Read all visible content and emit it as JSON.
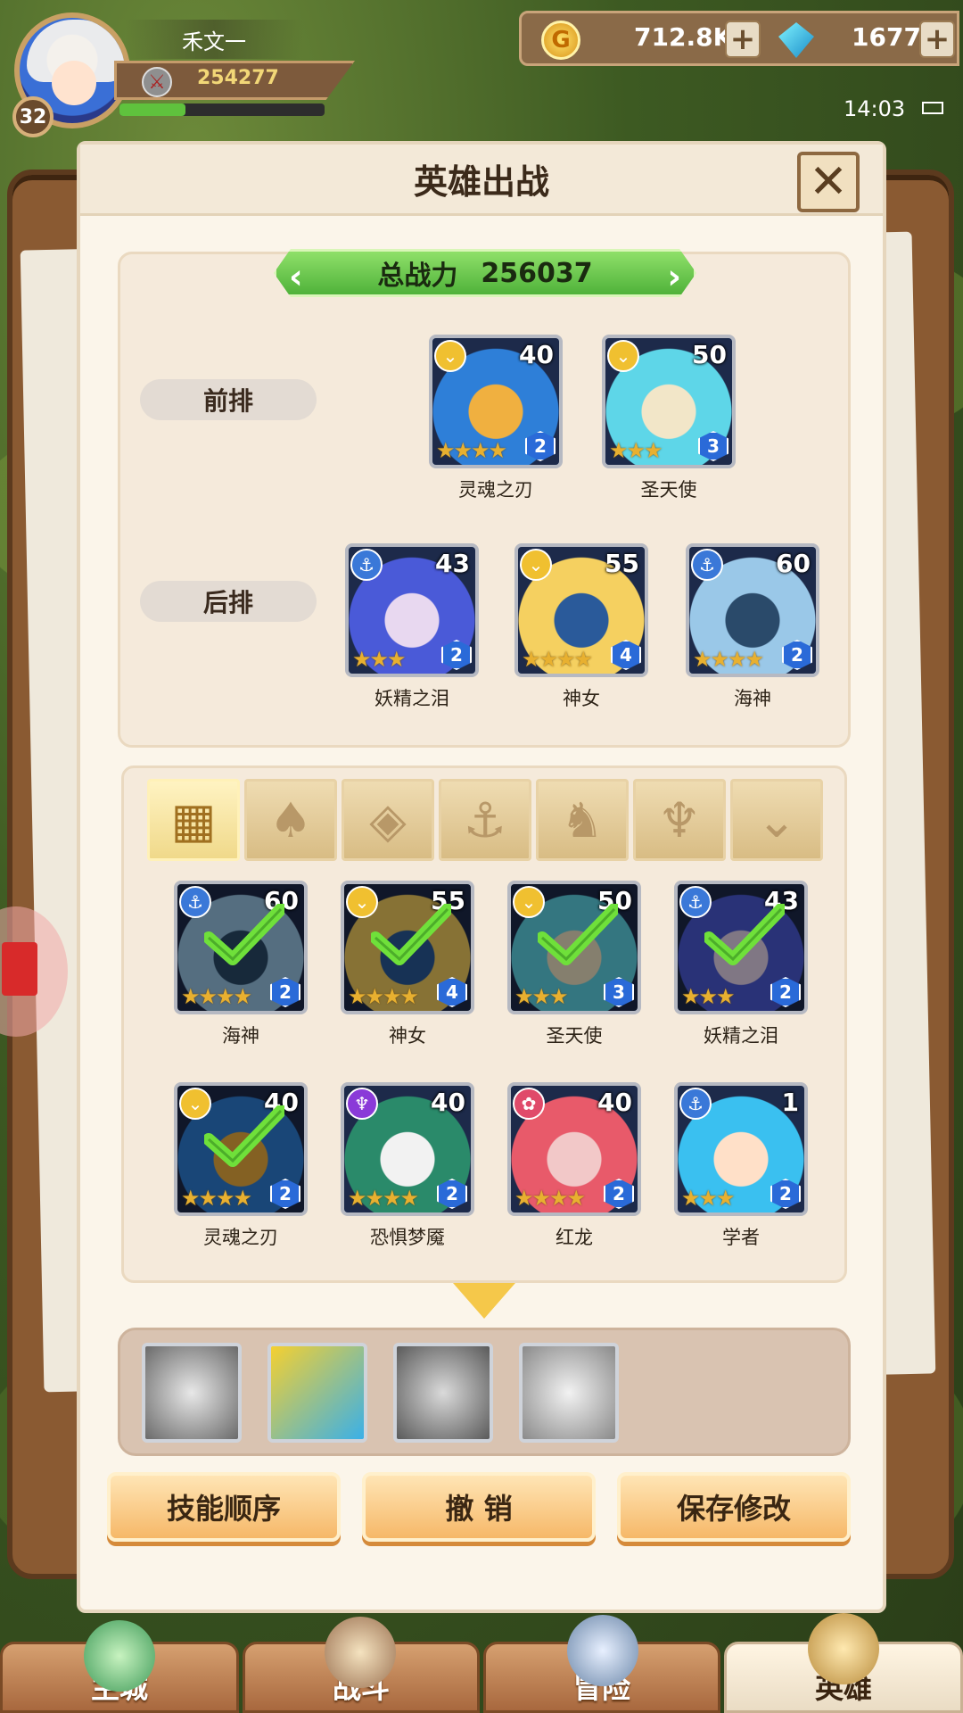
{
  "player": {
    "name": "禾文一",
    "level": "32",
    "power": "254277",
    "exp_fraction": 0.32
  },
  "currency": {
    "gold": "712.8K",
    "gems": "1677",
    "plus": "+"
  },
  "status": {
    "time": "14:03"
  },
  "dialog": {
    "title": "英雄出战",
    "close": "✕",
    "total_power_label": "总战力",
    "total_power_value": "256037",
    "front_row_label": "前排",
    "back_row_label": "后排"
  },
  "front_row": [
    {
      "name": "灵魂之刃",
      "level": "40",
      "stars": "★★★★",
      "tier": "2",
      "class": "shield"
    },
    {
      "name": "圣天使",
      "level": "50",
      "stars": "★★★",
      "tier": "3",
      "class": "shield"
    }
  ],
  "back_row": [
    {
      "name": "妖精之泪",
      "level": "43",
      "stars": "★★★",
      "tier": "2",
      "class": "anchor"
    },
    {
      "name": "神女",
      "level": "55",
      "stars": "★★★★",
      "tier": "4",
      "class": "shield"
    },
    {
      "name": "海神",
      "level": "60",
      "stars": "★★★★",
      "tier": "2",
      "class": "anchor"
    }
  ],
  "filters": [
    "all-icon",
    "nature-icon",
    "diamond-icon",
    "anchor-icon",
    "beast-icon",
    "horn-icon",
    "shield-icon"
  ],
  "roster": [
    {
      "name": "海神",
      "level": "60",
      "stars": "★★★★",
      "tier": "2",
      "class": "anchor",
      "selected": true
    },
    {
      "name": "神女",
      "level": "55",
      "stars": "★★★★",
      "tier": "4",
      "class": "shield",
      "selected": true
    },
    {
      "name": "圣天使",
      "level": "50",
      "stars": "★★★",
      "tier": "3",
      "class": "shield",
      "selected": true
    },
    {
      "name": "妖精之泪",
      "level": "43",
      "stars": "★★★",
      "tier": "2",
      "class": "anchor",
      "selected": true
    },
    {
      "name": "灵魂之刃",
      "level": "40",
      "stars": "★★★★",
      "tier": "2",
      "class": "shield",
      "selected": true
    },
    {
      "name": "恐惧梦魇",
      "level": "40",
      "stars": "★★★★",
      "tier": "2",
      "class": "horn",
      "selected": false
    },
    {
      "name": "红龙",
      "level": "40",
      "stars": "★★★★",
      "tier": "2",
      "class": "flame",
      "selected": false
    },
    {
      "name": "学者",
      "level": "1",
      "stars": "★★★",
      "tier": "2",
      "class": "anchor",
      "selected": false
    }
  ],
  "skills": [
    "skill-1-icon",
    "skill-2-icon",
    "skill-3-icon",
    "skill-4-icon"
  ],
  "buttons": {
    "skill_order": "技能顺序",
    "undo": "撤 销",
    "save": "保存修改"
  },
  "nav": {
    "home": "主城",
    "battle": "战斗",
    "adventure": "冒险",
    "heroes": "英雄"
  },
  "colors": {
    "accent_green": "#5fc23d",
    "button_orange": "#f6b868",
    "panel_bg": "#fbf5ea"
  }
}
